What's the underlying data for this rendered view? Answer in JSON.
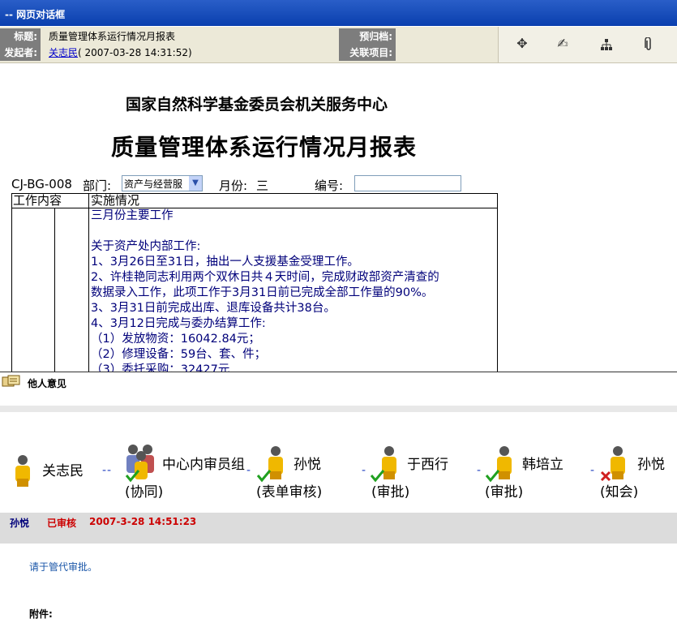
{
  "window": {
    "title": "-- 网页对话框"
  },
  "info": {
    "title_label": "标题:",
    "title_value": "质量管理体系运行情况月报表",
    "sender_label": "发起者:",
    "sender_name": "关志民",
    "sender_time": "( 2007-03-28 14:31:52)",
    "archive_label": "预归档:",
    "related_label": "关联项目:"
  },
  "toolbar": {
    "icons": [
      "move-icon",
      "handshake-icon",
      "org-tree-icon",
      "attachment-icon"
    ]
  },
  "document": {
    "org": "国家自然科学基金委员会机关服务中心",
    "title": "质量管理体系运行情况月报表",
    "code": "CJ-BG-008",
    "dept_label": "部门:",
    "dept_value": "资产与经营服",
    "month_label": "月份:",
    "month_value": "三",
    "number_label": "编号:",
    "number_value": "",
    "col1": "工作内容",
    "col2": "实施情况",
    "lines": [
      "三月份主要工作",
      "",
      "关于资产处内部工作:",
      "1、3月26日至31日，抽出一人支援基金受理工作。",
      "2、许桂艳同志利用两个双休日共４天时间，完成财政部资产清查的",
      "数据录入工作，此项工作于3月31日前已完成全部工作量的90%。",
      "3、3月31日前完成出库、退库设备共计38台。",
      "4、3月12日完成与委办结算工作:",
      "（1）发放物资：16042.84元；",
      "（2）修理设备：59台、套、件；",
      "（3）委托采购：32427元"
    ]
  },
  "opinions": {
    "title": "他人意见"
  },
  "flow": {
    "nodes": [
      {
        "name": "关志民",
        "role": ""
      },
      {
        "name": "中心内审员组",
        "role": "(协同)"
      },
      {
        "name": "孙悦",
        "role": "(表单审核)"
      },
      {
        "name": "于西行",
        "role": "(审批)"
      },
      {
        "name": "韩培立",
        "role": "(审批)"
      },
      {
        "name": "孙悦",
        "role": "(知会)"
      }
    ]
  },
  "opinion_entry": {
    "user": "孙悦",
    "status": "已审核",
    "time": "2007-3-28 14:51:23",
    "text": "请于管代审批。",
    "attachment_label": "附件:"
  },
  "colors": {
    "title_bar": "#0a3fae",
    "status_red": "#cc0000",
    "user_blue": "#00007a",
    "link_blue": "#0000cc"
  }
}
